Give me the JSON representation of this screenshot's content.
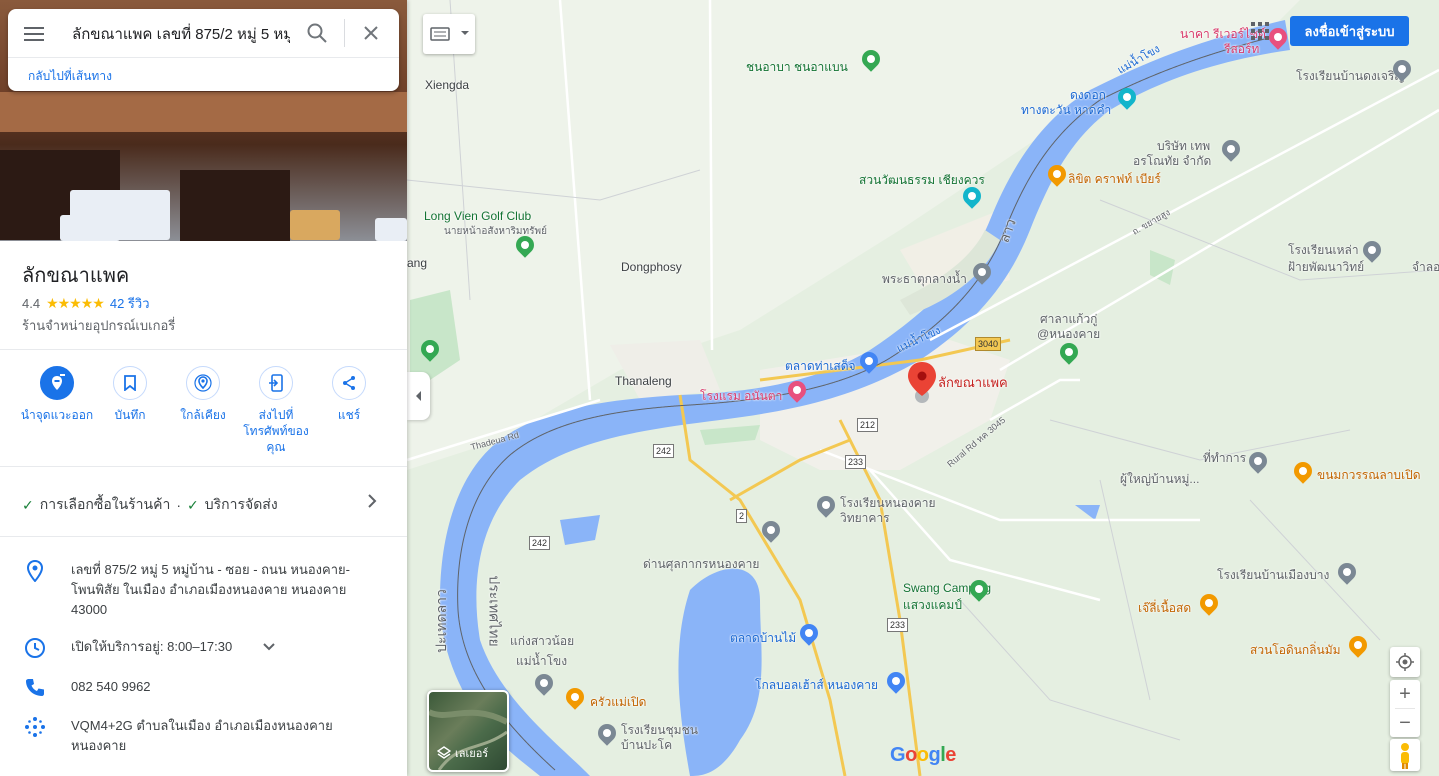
{
  "search": {
    "value": "ลักขณาแพค เลขที่ 875/2 หมู่ 5 หมู่บ้"
  },
  "back_link": "กลับไปที่เส้นทาง",
  "place": {
    "title": "ลักขณาแพค",
    "rating": "4.4",
    "stars": "★★★★★",
    "reviews": "42 รีวิว",
    "category": "ร้านจำหน่ายอุปกรณ์เบเกอรี่"
  },
  "actions": [
    {
      "label": "นำจุดแวะออก",
      "icon": "remove-stop-icon"
    },
    {
      "label": "บันทึก",
      "icon": "bookmark-icon"
    },
    {
      "label": "ใกล้เคียง",
      "icon": "nearby-icon"
    },
    {
      "label": "ส่งไปที่โทรศัพท์ของคุณ",
      "icon": "send-to-phone-icon"
    },
    {
      "label": "แชร์",
      "icon": "share-icon"
    }
  ],
  "services": {
    "in_store": "การเลือกซื้อในร้านค้า",
    "separator": "·",
    "delivery": "บริการจัดส่ง"
  },
  "info": {
    "address": "เลขที่ 875/2 หมู่ 5 หมู่บ้าน - ซอย - ถนน หนองคาย-โพนพิสัย ในเมือง อำเภอเมืองหนองคาย หนองคาย 43000",
    "hours_label": "เปิดให้บริการอยู่:",
    "hours_value": "8:00–17:30",
    "phone": "082 540 9962",
    "plus_code": "VQM4+2G ตำบลในเมือง อำเภอเมืองหนองคาย หนองคาย"
  },
  "map": {
    "signin": "ลงชื่อเข้าสู่ระบบ",
    "layer_label": "เลเยอร์",
    "zoom_in": "+",
    "zoom_out": "−",
    "labels": {
      "xiengda": "Xiengda",
      "longvien": "Long Vien Golf Club",
      "longvien_sub": "นายหน้าอสังหาริมทรัพย์",
      "dongphosy": "Dongphosy",
      "thanaleng": "Thanaleng",
      "thadeua": "Thadeua Rd",
      "hotel": "โรงแรม อนันตา",
      "market": "ตลาดท่าเสด็จ",
      "lakkhana": "ลักขณาแพค",
      "rural": "Rural Rd หค 3045",
      "school_nk": "โรงเรียนหนองคาย",
      "school_nk2": "วิทยาคาร",
      "museum": "ด่านศุลกากรหนองคาย",
      "swang": "Swang Camping",
      "swang_th": "แสวงแคมป์",
      "market2": "ตลาดบ้านไม้",
      "school_chumchon": "โรงเรียนชุมชน",
      "school_chumchon2": "บ้านปะโค",
      "krua": "ครัวแม่เปิด",
      "kaeng": "แก่งสาวน้อย",
      "kaeng2": "แม่น้ำโขง",
      "tharaphi": "ทางตะวัน หาดคำ",
      "dongdok": "ดงดอก",
      "suan": "สวนวัฒนธรรม เชียงควร",
      "lamcraft": "ลิขิต คราฟท์ เบียร์",
      "phrathat": "พระธาตุกลางน้ำ",
      "sala": "ศาลาแก้วกู่",
      "sala2": "@หนองคาย",
      "borisat": "บริษัท เทพ",
      "borisat2": "อรโณทัย จำกัด",
      "rongrian_dong": "โรงเรียนบ้านดงเจริญ",
      "rongrian_lao": "โรงเรียนเหล่า",
      "rongrian_lao2": "ฝ้ายพัฒนาวิทย์",
      "thi_kan": "ที่ทำการ",
      "thi_kan2": "ผู้ใหญ่บ้านหมู่...",
      "kanom": "ขนมกวรรณลาบเปิด",
      "rongrian_muang": "โรงเรียนบ้านเมืองบาง",
      "jeli": "เจ๊ลี่เนื้อสด",
      "suan_odin": "สวนโอดินกลิ่นมัม",
      "naka": "นาคา รีเวอร์ไซด์",
      "naka2": "รีสอร์ท",
      "bankok": "โกลบอลเฮ้าส์ หนองคาย",
      "sangha": "ชนอาบา ชนอาแบน",
      "lao_word": "ลาว",
      "mekong1": "แม่น้ำโขง",
      "mekong2": "แม่น้ำโขง",
      "pathet": "ประเทศไทย",
      "lao_vert": "ปะเทดลาว",
      "jam": "จำลอ",
      "lang": "ang",
      "rd_sangsoong": "ถ. ขยายสูง"
    },
    "shields": {
      "r242a": "242",
      "r242b": "242",
      "r212": "212",
      "r233a": "233",
      "r233b": "233",
      "r2": "2",
      "r3040": "3040"
    }
  }
}
